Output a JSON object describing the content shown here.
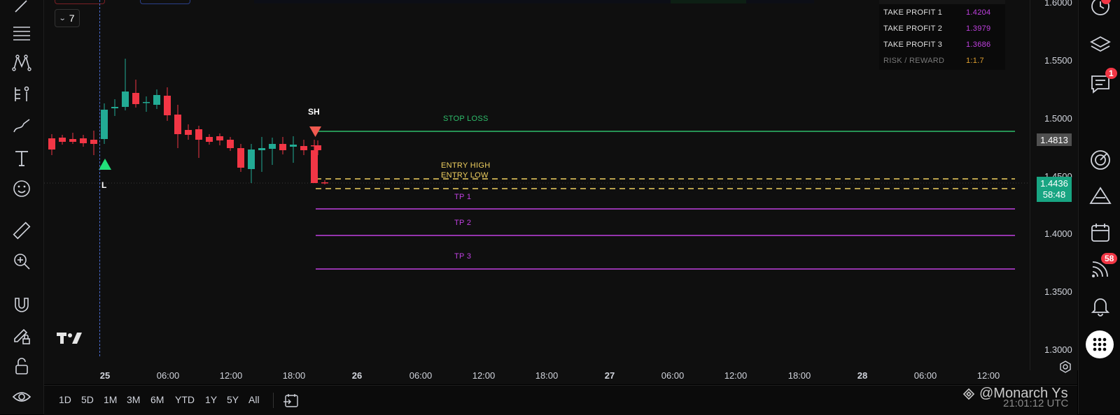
{
  "toolbar_left": {
    "tools": [
      "trend-line",
      "horizontal-lines",
      "pattern",
      "fib-pitchfork",
      "brush",
      "text",
      "emoji",
      "ruler",
      "zoom-in",
      "magnet",
      "lock-edit",
      "lock",
      "eye"
    ]
  },
  "interval": {
    "value": "7"
  },
  "chart": {
    "time_labels": [
      {
        "text": "25",
        "bold": true
      },
      {
        "text": "06:00",
        "bold": false
      },
      {
        "text": "12:00",
        "bold": false
      },
      {
        "text": "18:00",
        "bold": false
      },
      {
        "text": "26",
        "bold": true
      },
      {
        "text": "06:00",
        "bold": false
      },
      {
        "text": "12:00",
        "bold": false
      },
      {
        "text": "18:00",
        "bold": false
      },
      {
        "text": "27",
        "bold": true
      },
      {
        "text": "06:00",
        "bold": false
      },
      {
        "text": "12:00",
        "bold": false
      },
      {
        "text": "18:00",
        "bold": false
      },
      {
        "text": "28",
        "bold": true
      },
      {
        "text": "06:00",
        "bold": false
      },
      {
        "text": "12:00",
        "bold": false
      }
    ],
    "price_ticks": [
      "1.6000",
      "1.5500",
      "1.5000",
      "1.4500",
      "1.4000",
      "1.3500",
      "1.3000"
    ],
    "stop_loss_price": "1.4813",
    "current_price": "1.4436",
    "countdown": "58:48",
    "levels": {
      "stop_loss_label": "STOP LOSS",
      "entry_high_label": "ENTRY HIGH",
      "entry_low_label": "ENTRY LOW",
      "tp1_label": "TP 1",
      "tp2_label": "TP 2",
      "tp3_label": "TP 3"
    },
    "markers": {
      "swing_high": "SH",
      "low": "L"
    },
    "colors": {
      "up": "#22ab94",
      "down": "#f23645",
      "stop_loss": "#2ebd6b",
      "entry": "#f0d060",
      "take_profit": "#c040e0",
      "marker_up": "#22e07a",
      "marker_down": "#f05a50"
    }
  },
  "info_table": {
    "rows": [
      {
        "label": "TAKE PROFIT 1",
        "value": "1.4204"
      },
      {
        "label": "TAKE PROFIT 2",
        "value": "1.3979"
      },
      {
        "label": "TAKE PROFIT 3",
        "value": "1.3686"
      },
      {
        "label": "RISK / REWARD",
        "value": "1:1.7"
      }
    ]
  },
  "bottom_bar": {
    "ranges": [
      "1D",
      "5D",
      "1M",
      "3M",
      "6M",
      "YTD",
      "1Y",
      "5Y",
      "All"
    ],
    "clock": "21:01:12 UTC"
  },
  "watermark": {
    "text": "@Monarch Ys"
  },
  "right_sidebar": {
    "badges": {
      "alerts": "1",
      "news": "58"
    }
  }
}
